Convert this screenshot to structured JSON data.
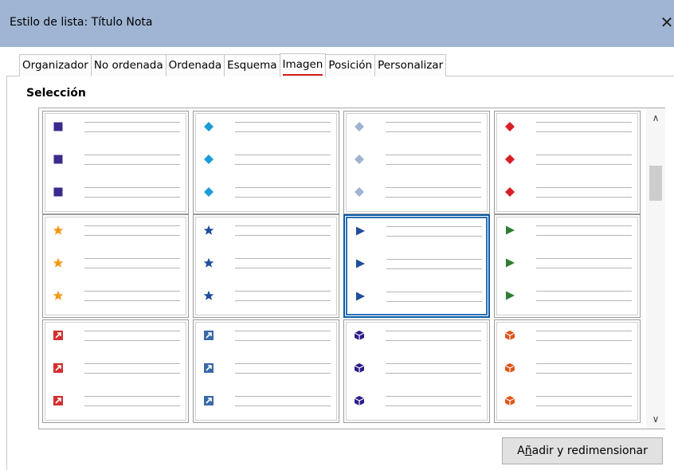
{
  "window": {
    "title": "Estilo de lista: Título Nota",
    "close_icon": "close-icon"
  },
  "tabs": [
    {
      "label": "Organizador",
      "active": false
    },
    {
      "label": "No ordenada",
      "active": false
    },
    {
      "label": "Ordenada",
      "active": false
    },
    {
      "label": "Esquema",
      "active": false
    },
    {
      "label": "Imagen",
      "active": true
    },
    {
      "label": "Posición",
      "active": false
    },
    {
      "label": "Personalizar",
      "active": false
    }
  ],
  "selection": {
    "label": "Selección",
    "selected_index": 6,
    "bullets": [
      {
        "icon": "purple-square-bullet-icon",
        "color": "#3b2a8c"
      },
      {
        "icon": "cyan-diamond-bullet-icon",
        "color": "#1e9bd7"
      },
      {
        "icon": "gray-diamond-bullet-icon",
        "color": "#9fb4cf"
      },
      {
        "icon": "red-diamond-bullet-icon",
        "color": "#d81f26"
      },
      {
        "icon": "orange-star-bullet-icon",
        "color": "#f29a1a"
      },
      {
        "icon": "blue-star-bullet-icon",
        "color": "#1f4e9c"
      },
      {
        "icon": "blue-triangle-bullet-icon",
        "color": "#1f4e9c"
      },
      {
        "icon": "green-triangle-bullet-icon",
        "color": "#2f7d32"
      },
      {
        "icon": "red-arrow-box-bullet-icon",
        "color": "#d32f2f"
      },
      {
        "icon": "blue-arrow-box-bullet-icon",
        "color": "#3a6aa6"
      },
      {
        "icon": "indigo-cube-bullet-icon",
        "color": "#2b1d8a"
      },
      {
        "icon": "orange-cube-bullet-icon",
        "color": "#e0561a"
      }
    ]
  },
  "buttons": {
    "resize_prefix": "A",
    "resize_accel": "ñ",
    "resize_suffix": "adir y redimensionar"
  },
  "scrollbar": {
    "up_icon": "chevron-up-icon",
    "down_icon": "chevron-down-icon"
  }
}
